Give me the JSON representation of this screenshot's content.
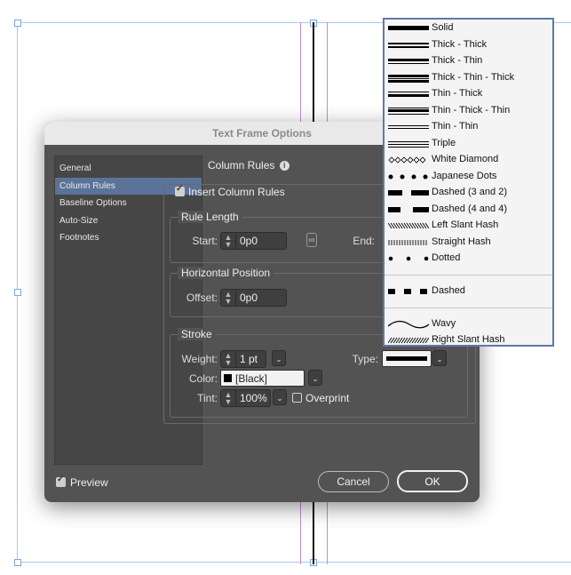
{
  "dialog": {
    "title": "Text Frame Options",
    "sidebar": [
      "General",
      "Column Rules",
      "Baseline Options",
      "Auto-Size",
      "Footnotes"
    ],
    "section_title": "Column Rules",
    "insert_rules_label": "Insert Column Rules",
    "rule_length": {
      "legend": "Rule Length",
      "start_label": "Start:",
      "start_value": "0p0",
      "end_label": "End:"
    },
    "horizontal_position": {
      "legend": "Horizontal Position",
      "offset_label": "Offset:",
      "offset_value": "0p0"
    },
    "stroke": {
      "legend": "Stroke",
      "weight_label": "Weight:",
      "weight_value": "1 pt",
      "type_label": "Type:",
      "color_label": "Color:",
      "color_value": "[Black]",
      "tint_label": "Tint:",
      "tint_value": "100%",
      "overprint_label": "Overprint"
    },
    "preview_label": "Preview",
    "cancel_label": "Cancel",
    "ok_label": "OK"
  },
  "stroke_types": [
    "Solid",
    "Thick - Thick",
    "Thick - Thin",
    "Thick - Thin - Thick",
    "Thin - Thick",
    "Thin - Thick - Thin",
    "Thin - Thin",
    "Triple",
    "White Diamond",
    "Japanese Dots",
    "Dashed (3 and 2)",
    "Dashed (4 and 4)",
    "Left Slant Hash",
    "Straight Hash",
    "Dotted",
    "Dashed",
    "Wavy",
    "Right Slant Hash"
  ],
  "colors": {
    "dialog_bg": "#535353",
    "selected_item": "#5c7399",
    "list_border": "#5e79a6"
  }
}
